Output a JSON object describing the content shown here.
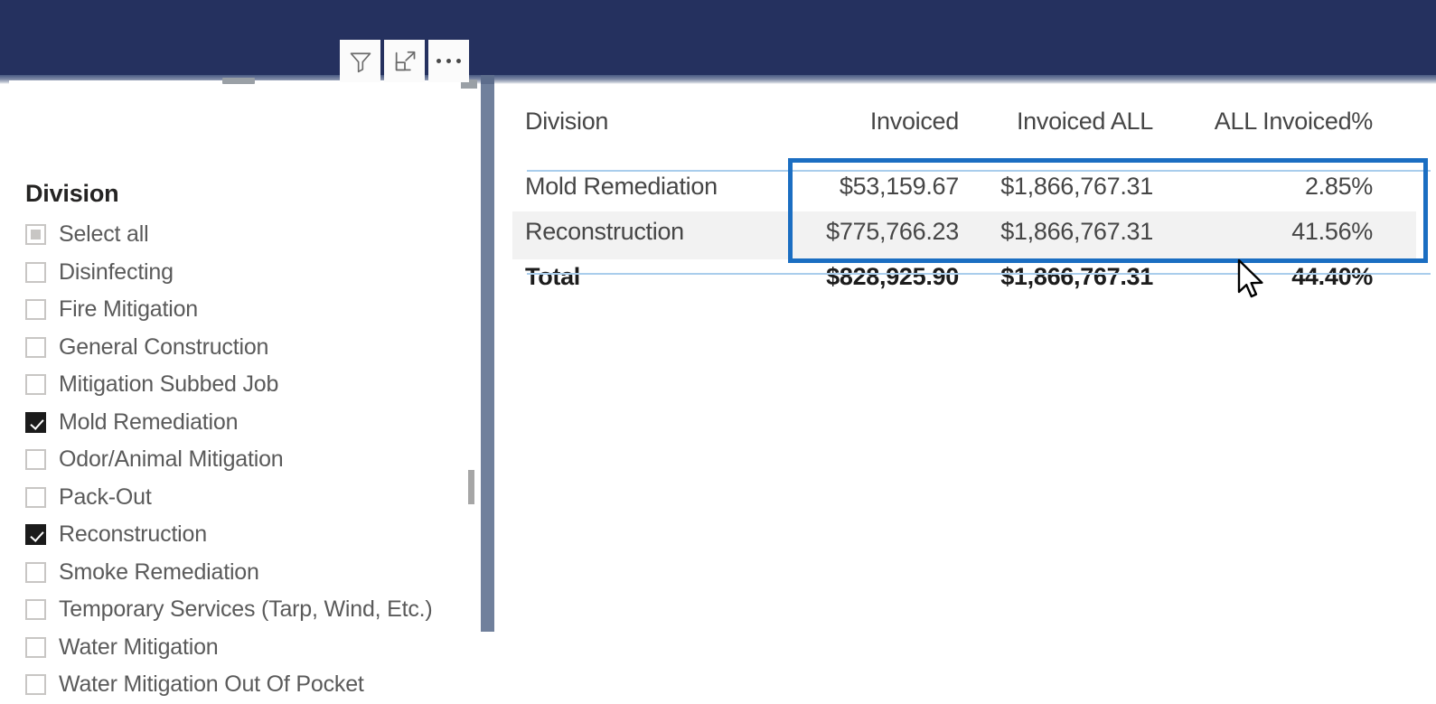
{
  "toolbar": {
    "buttons": [
      {
        "name": "filter-icon",
        "label": "Filters"
      },
      {
        "name": "focus-mode-icon",
        "label": "Focus mode"
      },
      {
        "name": "more-options-icon",
        "label": "More options"
      }
    ]
  },
  "slicer": {
    "title": "Division",
    "items": [
      {
        "label": "Select all",
        "state": "partial"
      },
      {
        "label": "Disinfecting",
        "state": "unchecked"
      },
      {
        "label": "Fire Mitigation",
        "state": "unchecked"
      },
      {
        "label": "General Construction",
        "state": "unchecked"
      },
      {
        "label": "Mitigation Subbed Job",
        "state": "unchecked"
      },
      {
        "label": "Mold Remediation",
        "state": "checked"
      },
      {
        "label": "Odor/Animal Mitigation",
        "state": "unchecked"
      },
      {
        "label": "Pack-Out",
        "state": "unchecked"
      },
      {
        "label": "Reconstruction",
        "state": "checked"
      },
      {
        "label": "Smoke Remediation",
        "state": "unchecked"
      },
      {
        "label": "Temporary Services (Tarp, Wind, Etc.)",
        "state": "unchecked"
      },
      {
        "label": "Water Mitigation",
        "state": "unchecked"
      },
      {
        "label": "Water Mitigation Out Of Pocket",
        "state": "unchecked"
      }
    ]
  },
  "table": {
    "columns": [
      "Division",
      "Invoiced",
      "Invoiced ALL",
      "ALL Invoiced%"
    ],
    "rows": [
      {
        "division": "Mold Remediation",
        "invoiced": "$53,159.67",
        "invoiced_all": "$1,866,767.31",
        "all_invoiced_pct": "2.85%"
      },
      {
        "division": "Reconstruction",
        "invoiced": "$775,766.23",
        "invoiced_all": "$1,866,767.31",
        "all_invoiced_pct": "41.56%"
      }
    ],
    "total": {
      "division": "Total",
      "invoiced": "$828,925.90",
      "invoiced_all": "$1,866,767.31",
      "all_invoiced_pct": "44.40%"
    }
  },
  "colors": {
    "header_navy": "#25315f",
    "selection_blue": "#1b6ec2",
    "row_band": "#f2f2f2",
    "active_cell": "#c4c4c4",
    "separator_blue": "#a9cdec",
    "gutter": "#70809c"
  }
}
